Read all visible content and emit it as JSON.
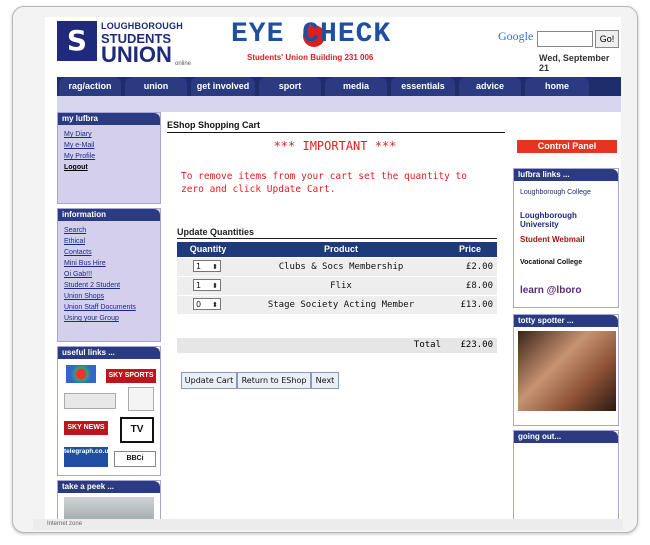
{
  "header": {
    "su_logo": {
      "line1": "LOUGHBOROUGH",
      "line2": "STUDENTS",
      "line3": "UNION",
      "line4": "online"
    },
    "eye_title": "EYE CHECK",
    "eye_sub": "Students' Union Building  231 006",
    "google_label": "Google",
    "google_go": "Go!",
    "date": "Wed, September 21"
  },
  "nav": [
    "rag/action",
    "union",
    "get involved",
    "sport",
    "media",
    "essentials",
    "advice",
    "home"
  ],
  "left": {
    "my_lufbra": {
      "title": "my lufbra",
      "links": [
        "My Diary",
        "My e-Mail",
        "My Profile",
        "Logout"
      ]
    },
    "information": {
      "title": "information",
      "links": [
        "Search",
        "Ethical",
        "Contacts",
        "Mini Bus Hire",
        "Oi Gab!!!",
        "Student 2 Student",
        "Union Shops",
        "Union Staff Documents",
        "Using your Group"
      ]
    },
    "useful_links": {
      "title": "useful links ...",
      "logos": [
        "SKY SPORTS",
        "SKY NEWS",
        "TV",
        "telegraph.co.uk",
        "BBCi"
      ]
    },
    "take_a_peek": {
      "title": "take a peek ..."
    }
  },
  "cart": {
    "title": "EShop Shopping Cart",
    "important": "*** IMPORTANT ***",
    "instruction": "To remove items from your cart set the quantity to zero and click Update Cart.",
    "update_title": "Update Quantities",
    "columns": [
      "Quantity",
      "Product",
      "Price"
    ],
    "rows": [
      {
        "qty": "1",
        "product": "Clubs & Socs Membership",
        "price": "£2.00"
      },
      {
        "qty": "1",
        "product": "Flix",
        "price": "£8.00"
      },
      {
        "qty": "0",
        "product": "Stage Society Acting Member",
        "price": "£13.00"
      }
    ],
    "total_label": "Total",
    "total_value": "£23.00",
    "buttons": [
      "Update Cart",
      "Return to EShop",
      "Next"
    ]
  },
  "right": {
    "control_panel": "Control Panel",
    "lufbra_links": {
      "title": "lufbra links ...",
      "items": [
        "Loughborough College",
        "Loughborough University",
        "Student Webmail",
        "Vocational College",
        "learn @lboro"
      ]
    },
    "totty_spotter": {
      "title": "totty spotter ..."
    },
    "going_out": {
      "title": "going out..."
    }
  },
  "status_bar": "Internet zone"
}
